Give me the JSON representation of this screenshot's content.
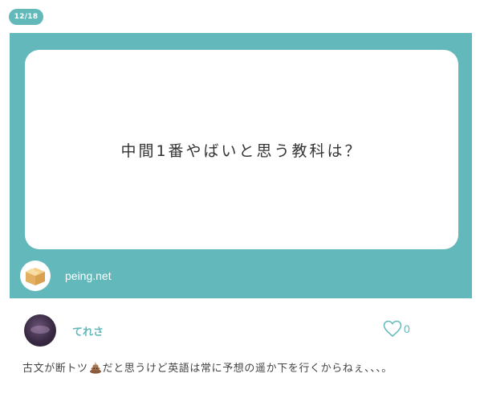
{
  "post": {
    "date_badge": "12/18",
    "question": "中間1番やばいと思う教科は？",
    "source_label": "peing.net",
    "source_icon": "box-icon"
  },
  "answer": {
    "user_name": "てれさ",
    "like_count": "0",
    "text_before": "古文が断トツ",
    "emoji": "pile-of-poo-icon",
    "text_after": "だと思うけど英語は常に予想の遥か下を行くからねぇ、、、。"
  },
  "colors": {
    "accent": "#63b8ba",
    "text": "#444444"
  }
}
